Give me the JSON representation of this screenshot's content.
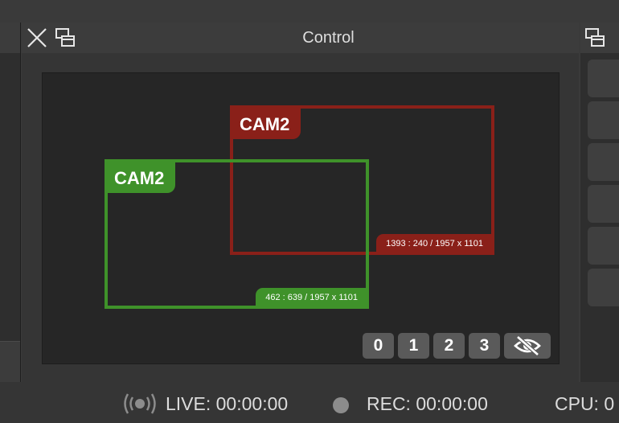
{
  "dock": {
    "title": "Control"
  },
  "preview": {
    "sources": [
      {
        "label": "CAM2",
        "coords": "1393 : 240 / 1957 x 1101",
        "color": "#8a2019"
      },
      {
        "label": "CAM2",
        "coords": "462 : 639 / 1957 x 1101",
        "color": "#3f922a"
      }
    ],
    "scene_buttons": [
      "0",
      "1",
      "2",
      "3"
    ]
  },
  "status": {
    "live": "LIVE: 00:00:00",
    "rec": "REC: 00:00:00",
    "cpu": "CPU: 0"
  },
  "icons": {
    "close": "close-icon",
    "float": "float-window-icon",
    "eye": "eye-off-icon",
    "live": "broadcast-icon",
    "rec": "record-dot-icon"
  }
}
